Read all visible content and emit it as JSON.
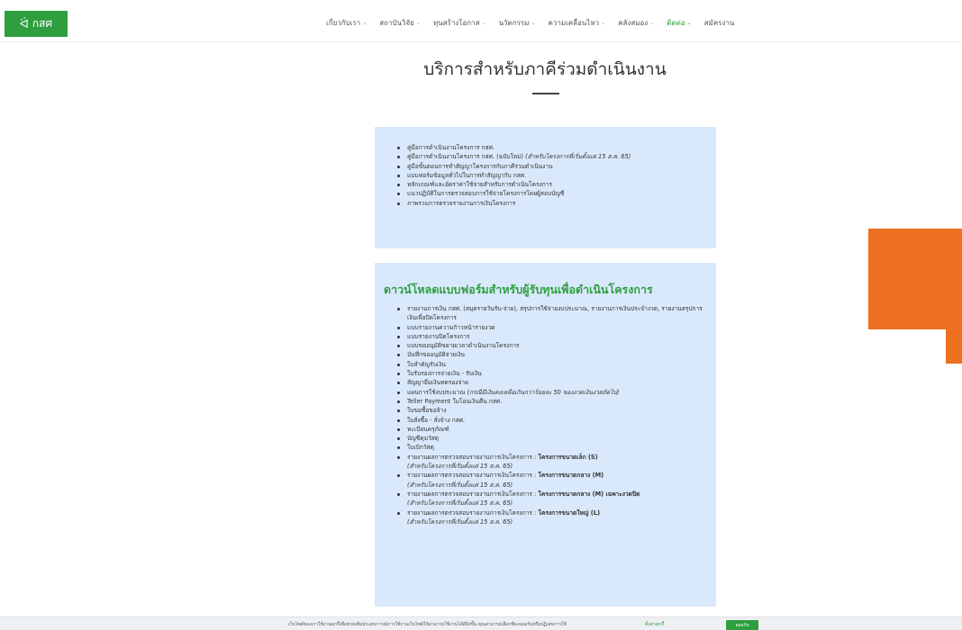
{
  "header": {
    "logo_text": "กสศ",
    "logo_icon": "handshake-logo-icon",
    "nav": [
      {
        "label": "เกี่ยวกับเรา",
        "active": false
      },
      {
        "label": "สถาบันวิจัย",
        "active": false
      },
      {
        "label": "ทุนสร้างโอกาส",
        "active": false
      },
      {
        "label": "นวัตกรรม",
        "active": false
      },
      {
        "label": "ความเคลื่อนไหว",
        "active": false
      },
      {
        "label": "คลังสมอง",
        "active": false
      },
      {
        "label": "ติดต่อ",
        "active": true
      },
      {
        "label": "สมัครงาน",
        "active": false
      }
    ],
    "chevron_icon": "chevron-down-icon"
  },
  "page": {
    "title": "บริการสำหรับภาคีร่วมดำเนินงาน"
  },
  "panel1": {
    "items": [
      {
        "text": "คู่มือการดำเนินงานโครงการ กสศ."
      },
      {
        "text": "คู่มือการดำเนินงานโครงการ กสศ. (ฉบับใหม่)",
        "note": "(สำหรับโครงการที่เริ่มตั้งแต่ 15 ส.ค. 65)"
      },
      {
        "text": "คู่มือขั้นตอนการทำสัญญาโครงการกับภาคีร่วมดำเนินงาน"
      },
      {
        "text": "แบบฟอร์มข้อมูลทั่วไปในการทำสัญญากับ กสศ."
      },
      {
        "text": "หลักเกณฑ์และอัตราค่าใช้จ่ายสำหรับการดำเนินโครงการ"
      },
      {
        "text": "แนวปฏิบัติในการตรวจสอบการใช้จ่ายโครงการโดยผู้สอบบัญชี"
      },
      {
        "text": "ภาพรวมการตรวจรายงานการเงินโครงการ"
      }
    ]
  },
  "panel2": {
    "heading": "ดาวน์โหลดแบบฟอร์มสำหรับผู้รับทุนเพื่อดำเนินโครงการ",
    "items": [
      {
        "text": "รายงานการเงิน กสศ. (สมุดรายวันรับ-จ่าย), สรุปการใช้จ่ายงบประมาณ, รายงานการเงินประจำงวด, รายงานสรุปการเงินเพื่อปิดโครงการ"
      },
      {
        "text": "แบบรายงานความก้าวหน้ารายงวด"
      },
      {
        "text": "แบบรายงานปิดโครงการ"
      },
      {
        "text": "แบบขออนุมัติขยายเวลาดำเนินงานโครงการ"
      },
      {
        "text": "บันทึกขออนุมัติจ่ายเงิน"
      },
      {
        "text": "ใบสำคัญรับเงิน"
      },
      {
        "text": "ใบรับรองการจ่ายเงิน - รับเงิน"
      },
      {
        "text": "สัญญายืมเงินทดรองจ่าย"
      },
      {
        "text": "แผนการใช้งบประมาณ",
        "note": "(กรณีมีเงินคงเหลือเกินกว่าร้อยละ 50 ของงวดเงินงวดถัดไป)"
      },
      {
        "text": "Teller Payment ใบโอนเงินคืน กสศ."
      },
      {
        "text": "ใบขอซื้อขอจ้าง"
      },
      {
        "text": "ใบสั่งซื้อ - สั่งจ้าง กสศ."
      },
      {
        "text": "ทะเบียนครุภัณฑ์"
      },
      {
        "text": "บัญชีคุมวัสดุ"
      },
      {
        "text": "ใบเบิกวัสดุ"
      },
      {
        "text": "รายงานผลการตรวจสอบรายงานการเงินโครงการ :",
        "bold": "โครงการขนาดเล็ก (S)",
        "sub": "(สำหรับโครงการที่เริ่มตั้งแต่ 15 ส.ค. 65)"
      },
      {
        "text": "รายงานผลการตรวจสอบรายงานการเงินโครงการ :",
        "bold": "โครงการขนาดกลาง (M)",
        "sub": "(สำหรับโครงการที่เริ่มตั้งแต่ 15 ส.ค. 65)"
      },
      {
        "text": "รายงานผลการตรวจสอบรายงานการเงินโครงการ :",
        "bold": "โครงการขนาดกลาง (M) เฉพาะงวดปิด",
        "sub": "(สำหรับโครงการที่เริ่มตั้งแต่ 15 ส.ค. 65)"
      },
      {
        "text": "รายงานผลการตรวจสอบรายงานการเงินโครงการ :",
        "bold": "โครงการขนาดใหญ่ (L)",
        "sub": "(สำหรับโครงการที่เริ่มตั้งแต่ 15 ส.ค. 65)"
      }
    ]
  },
  "cookie": {
    "text": "เว็บไซต์ของเราใช้งานคุกกี้เพื่อช่วยเพิ่มประสบการณ์การใช้งานเว็บไซต์ให้สามารถใช้งานได้ดียิ่งขึ้น คุณสามารถเลือกที่จะยอมรับหรือปฏิเสธการใช้",
    "link": "ตั้งค่าคุกกี้",
    "button": "ยอมรับ"
  },
  "colors": {
    "brand_green": "#2e9e3f",
    "panel_blue": "#d9e9fb",
    "arrow_orange": "#ec7020"
  }
}
